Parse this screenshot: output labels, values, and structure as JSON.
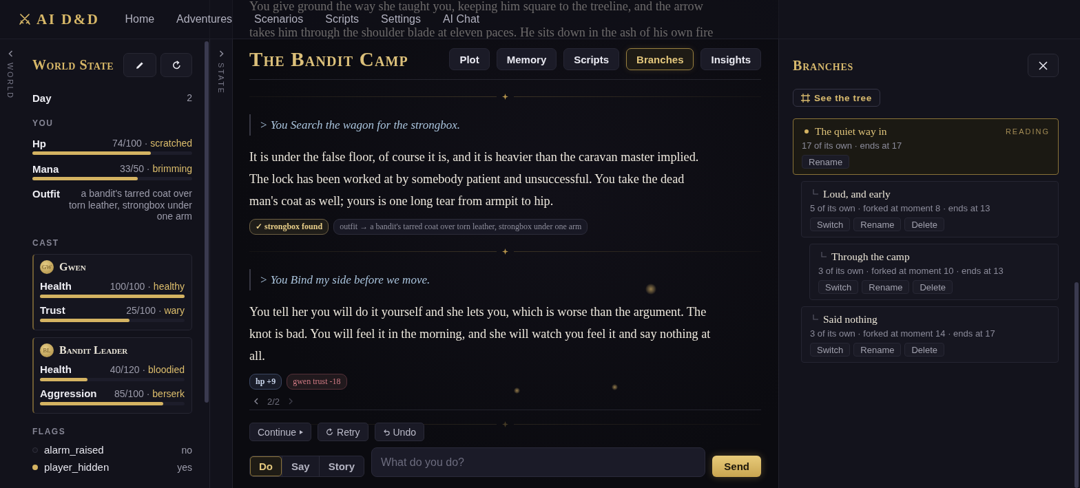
{
  "nav": {
    "logo": "AI D&D",
    "links": [
      "Home",
      "Adventures",
      "Scenarios",
      "Scripts",
      "Settings",
      "AI Chat"
    ]
  },
  "world": {
    "rail_label": "WORLD",
    "title": "World State",
    "day": {
      "label": "Day",
      "value": "2"
    },
    "you": {
      "heading": "YOU",
      "stats": [
        {
          "label": "Hp",
          "reading": "74/100 ·",
          "status": "scratched",
          "level": 0.74
        },
        {
          "label": "Mana",
          "reading": "33/50 ·",
          "status": "brimming",
          "level": 0.66
        }
      ],
      "outfit": {
        "label": "Outfit",
        "value": "a bandit's tarred coat over torn leather, strongbox under one arm"
      }
    },
    "cast": {
      "heading": "CAST",
      "characters": [
        {
          "initials": "GW",
          "name": "Gwen",
          "stats": [
            {
              "label": "Health",
              "reading": "100/100 ·",
              "status": "healthy",
              "level": 1
            },
            {
              "label": "Trust",
              "reading": "25/100 ·",
              "status": "wary",
              "level": 0.62
            }
          ]
        },
        {
          "initials": "BL",
          "name": "Bandit Leader",
          "stats": [
            {
              "label": "Health",
              "reading": "40/120 ·",
              "status": "bloodied",
              "level": 0.33
            },
            {
              "label": "Aggression",
              "reading": "85/100 ·",
              "status": "berserk",
              "level": 0.85
            }
          ]
        }
      ]
    },
    "flags": {
      "heading": "FLAGS",
      "items": [
        {
          "name": "alarm_raised",
          "value": "no",
          "on": false
        },
        {
          "name": "player_hidden",
          "value": "yes",
          "on": true
        }
      ]
    }
  },
  "state_rail": {
    "label": "STATE"
  },
  "story": {
    "scrolled_lines": [
      "You give ground the way she taught you, keeping him square to the treeline, and the arrow",
      "takes him through the shoulder blade at eleven paces. He sits down in the ash of his own fire"
    ],
    "title": "The Bandit Camp",
    "tabs": [
      {
        "label": "Plot",
        "selected": false
      },
      {
        "label": "Memory",
        "selected": false
      },
      {
        "label": "Scripts",
        "selected": false
      },
      {
        "label": "Branches",
        "selected": true
      },
      {
        "label": "Insights",
        "selected": false
      }
    ],
    "turns": [
      {
        "action": "> You Search the wagon for the strongbox.",
        "narration": "It is under the false floor, of course it is, and it is heavier than the caravan master implied. The lock has been worked at by somebody patient and unsuccessful. You take the dead man's coat as well; yours is one long tear from armpit to hip.",
        "tags": [
          {
            "text": "✓ strongbox found",
            "kind": "gain"
          },
          {
            "text": "outfit → a bandit's tarred coat over torn leather, strongbox under one arm",
            "kind": "change"
          }
        ]
      },
      {
        "action": "> You Bind my side before we move.",
        "narration": "You tell her you will do it yourself and she lets you, which is worse than the argument. The knot is bad. You will feel it in the morning, and she will watch you feel it and say nothing at all.",
        "tags": [
          {
            "text": "hp +9",
            "kind": "up"
          },
          {
            "text": "gwen trust -18",
            "kind": "down"
          }
        ]
      }
    ],
    "pager": {
      "label": "2/2",
      "prev_disabled": false,
      "next_disabled": true
    },
    "actions": [
      {
        "label": "Continue",
        "kind": "continue"
      },
      {
        "label": "Retry",
        "kind": "retry"
      },
      {
        "label": "Undo",
        "kind": "undo"
      }
    ],
    "composer": {
      "modes": [
        {
          "label": "Do",
          "selected": true
        },
        {
          "label": "Say",
          "selected": false
        },
        {
          "label": "Story",
          "selected": false
        }
      ],
      "placeholder": "What do you do?",
      "send": "Send"
    }
  },
  "branches_panel": {
    "title": "Branches",
    "tree_button": "See the tree",
    "branches": [
      {
        "title": "The quiet way in",
        "selected": true,
        "badge": "READING",
        "meta": "17 of its own · ends at 17",
        "actions": [
          "Rename"
        ],
        "children": [
          {
            "title": "Loud, and early",
            "selected": false,
            "meta": "5 of its own · forked at moment 8 · ends at 13",
            "actions": [
              "Switch",
              "Rename",
              "Delete"
            ],
            "children": [
              {
                "title": "Through the camp",
                "selected": false,
                "meta": "3 of its own · forked at moment 10 · ends at 13",
                "actions": [
                  "Switch",
                  "Rename",
                  "Delete"
                ]
              }
            ]
          },
          {
            "title": "Said nothing",
            "selected": false,
            "meta": "3 of its own · forked at moment 14 · ends at 17",
            "actions": [
              "Switch",
              "Rename",
              "Delete"
            ]
          }
        ]
      }
    ]
  }
}
